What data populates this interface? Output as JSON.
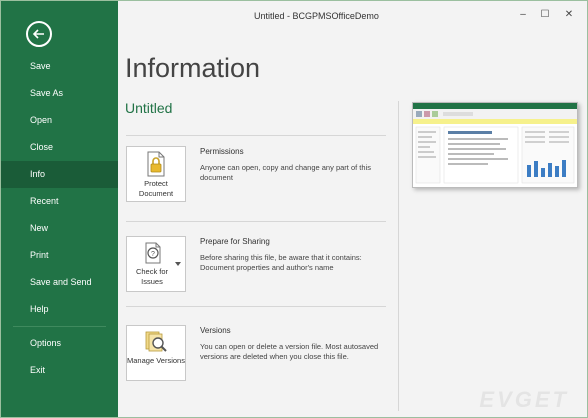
{
  "window": {
    "title": "Untitled - BCGPMSOfficeDemo",
    "minimize_glyph": "–",
    "maximize_glyph": "☐",
    "close_glyph": "✕"
  },
  "sidebar": {
    "back_icon": "back-arrow-icon",
    "items": [
      {
        "label": "Save"
      },
      {
        "label": "Save As"
      },
      {
        "label": "Open"
      },
      {
        "label": "Close"
      },
      {
        "label": "Info"
      },
      {
        "label": "Recent"
      },
      {
        "label": "New"
      },
      {
        "label": "Print"
      },
      {
        "label": "Save and Send"
      },
      {
        "label": "Help"
      },
      {
        "label": "Options"
      },
      {
        "label": "Exit"
      }
    ],
    "selected": "Info"
  },
  "main": {
    "heading": "Information",
    "document_name": "Untitled",
    "sections": [
      {
        "button_label": "Protect Document",
        "icon": "lock-document-icon",
        "title": "Permissions",
        "description": "Anyone can open, copy and change any part of this document"
      },
      {
        "button_label": "Check for Issues",
        "icon": "inspect-document-icon",
        "title": "Prepare for Sharing",
        "description": "Before sharing this file, be aware that it contains: Document properties and  author's name"
      },
      {
        "button_label": "Manage Versions",
        "icon": "versions-magnifier-icon",
        "title": "Versions",
        "description": "You can open or delete a version file. Most autosaved versions are deleted when you close this file."
      }
    ]
  },
  "colors": {
    "accent": "#217346",
    "selected": "#1a5c38"
  }
}
